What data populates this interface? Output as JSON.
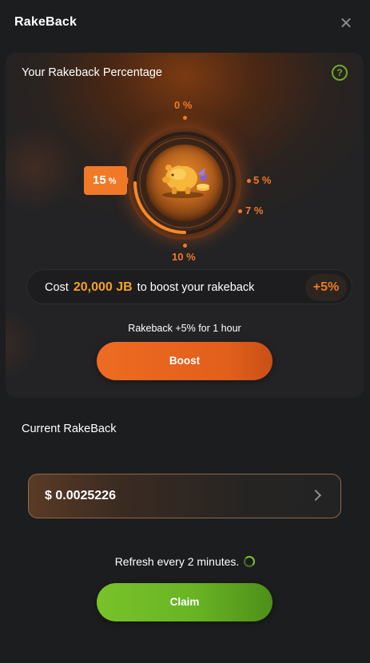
{
  "header": {
    "title": "RakeBack",
    "close_icon": "close-icon"
  },
  "percentage_card": {
    "title": "Your Rakeback Percentage",
    "help_icon": "question-circle-icon",
    "help_symbol": "?",
    "current_level": {
      "value": "15",
      "unit": "%"
    },
    "dial_marks": [
      {
        "label": "0 %"
      },
      {
        "label": "5 %"
      },
      {
        "label": "7 %"
      },
      {
        "label": "10 %"
      }
    ],
    "center_icon": "piggy-bank-icon",
    "cost": {
      "prefix": "Cost",
      "amount": "20,000 JB",
      "suffix": "to boost your rakeback",
      "boost_badge": "+5%"
    },
    "boost_note": "Rakeback +5% for 1 hour",
    "boost_button": "Boost"
  },
  "current": {
    "title": "Current RakeBack",
    "value": "$ 0.0025226",
    "chevron_icon": "chevron-right-icon"
  },
  "refresh": {
    "text": "Refresh every 2 minutes.",
    "icon": "refresh-spinner-icon"
  },
  "claim_button": "Claim",
  "colors": {
    "accent_orange": "#f07a28",
    "amount_gold": "#f7a21b",
    "claim_green": "#6cb825",
    "background": "#1c1d1f"
  }
}
